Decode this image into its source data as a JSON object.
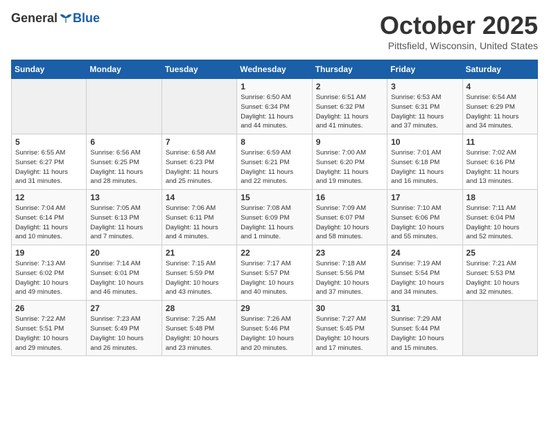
{
  "header": {
    "logo_general": "General",
    "logo_blue": "Blue",
    "month": "October 2025",
    "location": "Pittsfield, Wisconsin, United States"
  },
  "weekdays": [
    "Sunday",
    "Monday",
    "Tuesday",
    "Wednesday",
    "Thursday",
    "Friday",
    "Saturday"
  ],
  "weeks": [
    [
      {
        "day": "",
        "info": ""
      },
      {
        "day": "",
        "info": ""
      },
      {
        "day": "",
        "info": ""
      },
      {
        "day": "1",
        "info": "Sunrise: 6:50 AM\nSunset: 6:34 PM\nDaylight: 11 hours\nand 44 minutes."
      },
      {
        "day": "2",
        "info": "Sunrise: 6:51 AM\nSunset: 6:32 PM\nDaylight: 11 hours\nand 41 minutes."
      },
      {
        "day": "3",
        "info": "Sunrise: 6:53 AM\nSunset: 6:31 PM\nDaylight: 11 hours\nand 37 minutes."
      },
      {
        "day": "4",
        "info": "Sunrise: 6:54 AM\nSunset: 6:29 PM\nDaylight: 11 hours\nand 34 minutes."
      }
    ],
    [
      {
        "day": "5",
        "info": "Sunrise: 6:55 AM\nSunset: 6:27 PM\nDaylight: 11 hours\nand 31 minutes."
      },
      {
        "day": "6",
        "info": "Sunrise: 6:56 AM\nSunset: 6:25 PM\nDaylight: 11 hours\nand 28 minutes."
      },
      {
        "day": "7",
        "info": "Sunrise: 6:58 AM\nSunset: 6:23 PM\nDaylight: 11 hours\nand 25 minutes."
      },
      {
        "day": "8",
        "info": "Sunrise: 6:59 AM\nSunset: 6:21 PM\nDaylight: 11 hours\nand 22 minutes."
      },
      {
        "day": "9",
        "info": "Sunrise: 7:00 AM\nSunset: 6:20 PM\nDaylight: 11 hours\nand 19 minutes."
      },
      {
        "day": "10",
        "info": "Sunrise: 7:01 AM\nSunset: 6:18 PM\nDaylight: 11 hours\nand 16 minutes."
      },
      {
        "day": "11",
        "info": "Sunrise: 7:02 AM\nSunset: 6:16 PM\nDaylight: 11 hours\nand 13 minutes."
      }
    ],
    [
      {
        "day": "12",
        "info": "Sunrise: 7:04 AM\nSunset: 6:14 PM\nDaylight: 11 hours\nand 10 minutes."
      },
      {
        "day": "13",
        "info": "Sunrise: 7:05 AM\nSunset: 6:13 PM\nDaylight: 11 hours\nand 7 minutes."
      },
      {
        "day": "14",
        "info": "Sunrise: 7:06 AM\nSunset: 6:11 PM\nDaylight: 11 hours\nand 4 minutes."
      },
      {
        "day": "15",
        "info": "Sunrise: 7:08 AM\nSunset: 6:09 PM\nDaylight: 11 hours\nand 1 minute."
      },
      {
        "day": "16",
        "info": "Sunrise: 7:09 AM\nSunset: 6:07 PM\nDaylight: 10 hours\nand 58 minutes."
      },
      {
        "day": "17",
        "info": "Sunrise: 7:10 AM\nSunset: 6:06 PM\nDaylight: 10 hours\nand 55 minutes."
      },
      {
        "day": "18",
        "info": "Sunrise: 7:11 AM\nSunset: 6:04 PM\nDaylight: 10 hours\nand 52 minutes."
      }
    ],
    [
      {
        "day": "19",
        "info": "Sunrise: 7:13 AM\nSunset: 6:02 PM\nDaylight: 10 hours\nand 49 minutes."
      },
      {
        "day": "20",
        "info": "Sunrise: 7:14 AM\nSunset: 6:01 PM\nDaylight: 10 hours\nand 46 minutes."
      },
      {
        "day": "21",
        "info": "Sunrise: 7:15 AM\nSunset: 5:59 PM\nDaylight: 10 hours\nand 43 minutes."
      },
      {
        "day": "22",
        "info": "Sunrise: 7:17 AM\nSunset: 5:57 PM\nDaylight: 10 hours\nand 40 minutes."
      },
      {
        "day": "23",
        "info": "Sunrise: 7:18 AM\nSunset: 5:56 PM\nDaylight: 10 hours\nand 37 minutes."
      },
      {
        "day": "24",
        "info": "Sunrise: 7:19 AM\nSunset: 5:54 PM\nDaylight: 10 hours\nand 34 minutes."
      },
      {
        "day": "25",
        "info": "Sunrise: 7:21 AM\nSunset: 5:53 PM\nDaylight: 10 hours\nand 32 minutes."
      }
    ],
    [
      {
        "day": "26",
        "info": "Sunrise: 7:22 AM\nSunset: 5:51 PM\nDaylight: 10 hours\nand 29 minutes."
      },
      {
        "day": "27",
        "info": "Sunrise: 7:23 AM\nSunset: 5:49 PM\nDaylight: 10 hours\nand 26 minutes."
      },
      {
        "day": "28",
        "info": "Sunrise: 7:25 AM\nSunset: 5:48 PM\nDaylight: 10 hours\nand 23 minutes."
      },
      {
        "day": "29",
        "info": "Sunrise: 7:26 AM\nSunset: 5:46 PM\nDaylight: 10 hours\nand 20 minutes."
      },
      {
        "day": "30",
        "info": "Sunrise: 7:27 AM\nSunset: 5:45 PM\nDaylight: 10 hours\nand 17 minutes."
      },
      {
        "day": "31",
        "info": "Sunrise: 7:29 AM\nSunset: 5:44 PM\nDaylight: 10 hours\nand 15 minutes."
      },
      {
        "day": "",
        "info": ""
      }
    ]
  ]
}
